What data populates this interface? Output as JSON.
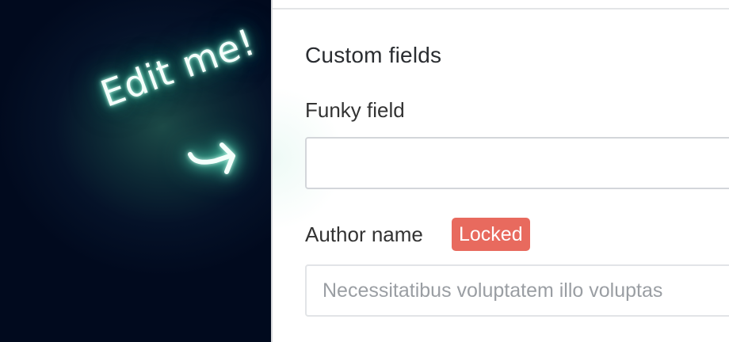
{
  "overlay": {
    "annotation_text": "Edit me!",
    "arrow_icon": "curved-arrow-icon",
    "glow_color": "#58d9b8",
    "background_color": "#010a1e"
  },
  "form": {
    "section_title": "Custom fields",
    "fields": [
      {
        "label": "Funky field",
        "value": "",
        "placeholder": ""
      },
      {
        "label": "Author name",
        "badge": "Locked",
        "placeholder": "Necessitatibus voluptatem illo voluptas"
      }
    ]
  },
  "colors": {
    "badge_bg": "#e86a5e",
    "badge_text": "#ffffff"
  }
}
